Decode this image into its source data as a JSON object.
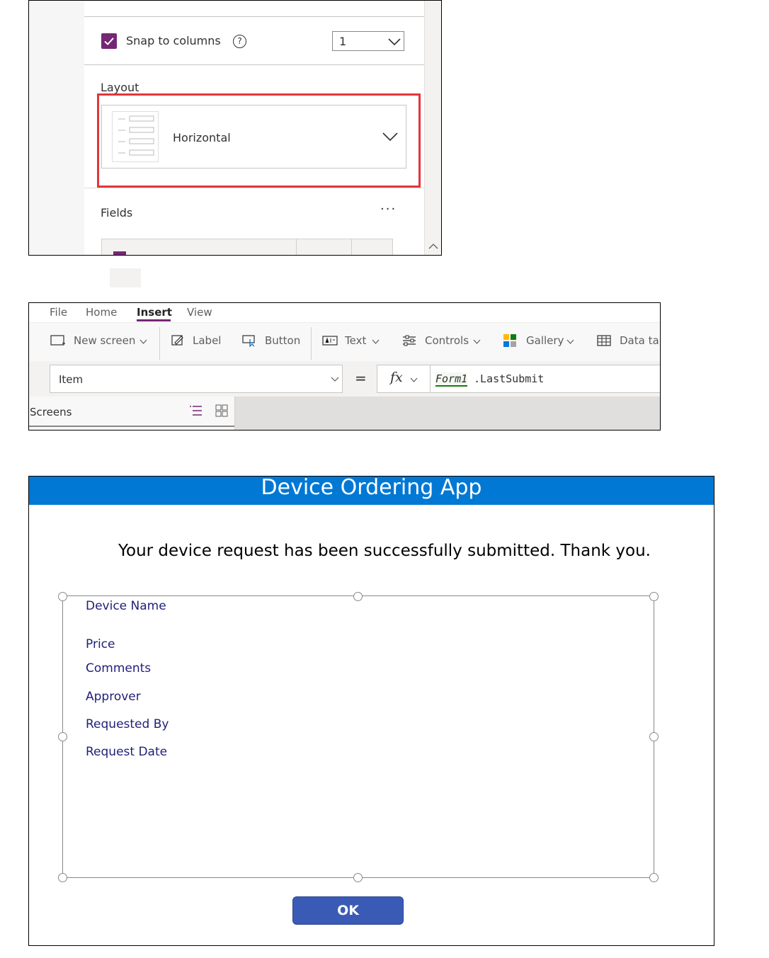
{
  "panel1": {
    "snap_to_columns": {
      "label": "Snap to columns",
      "checked": true,
      "help": "?"
    },
    "columns_dropdown": {
      "value": "1"
    },
    "layout": {
      "label": "Layout",
      "value": "Horizontal"
    },
    "fields": {
      "label": "Fields",
      "more": "···"
    }
  },
  "panel2": {
    "menu": {
      "file": "File",
      "home": "Home",
      "insert": "Insert",
      "view": "View"
    },
    "ribbon": {
      "new_screen": "New screen",
      "label": "Label",
      "button": "Button",
      "text": "Text",
      "controls": "Controls",
      "gallery": "Gallery",
      "data_table": "Data ta"
    },
    "formula_bar": {
      "property": "Item",
      "equals": "=",
      "fx": "fx",
      "formula_object": "Form1",
      "formula_rest": ".LastSubmit"
    },
    "screens_label": "Screens"
  },
  "panel3": {
    "app_title": "Device Ordering App",
    "message": "Your device request has been successfully submitted. Thank you.",
    "fields": [
      "Device Name",
      "Price",
      "Comments",
      "Approver",
      "Requested By",
      "Request Date"
    ],
    "ok_button": "OK"
  },
  "colors": {
    "checkbox": "#742774",
    "highlight_red": "#e2363c",
    "app_header": "#0078d4",
    "ok_button": "#3a5bb5",
    "field_label": "#1f1f7a"
  }
}
